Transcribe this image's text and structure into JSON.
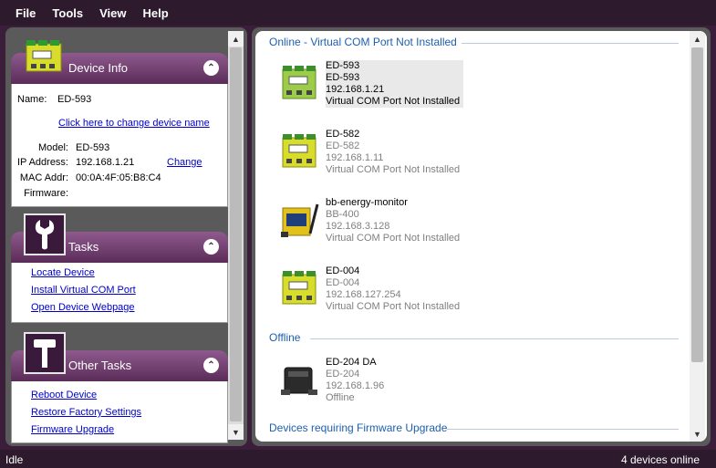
{
  "menu": [
    "File",
    "Tools",
    "View",
    "Help"
  ],
  "device_info": {
    "title": "Device Info",
    "name_label": "Name:",
    "name_value": "ED-593",
    "change_name_link": "Click here to change device name",
    "model_label": "Model:",
    "model_value": "ED-593",
    "ip_label": "IP Address:",
    "ip_value": "192.168.1.21",
    "change_link": "Change",
    "mac_label": "MAC Addr:",
    "mac_value": "00:0A:4F:05:B8:C4",
    "firmware_label": "Firmware:"
  },
  "tasks": {
    "title": "Tasks",
    "items": [
      "Locate Device",
      "Install Virtual COM Port",
      "Open Device Webpage"
    ]
  },
  "other_tasks": {
    "title": "Other Tasks",
    "items": [
      "Reboot Device",
      "Restore Factory Settings",
      "Firmware Upgrade"
    ]
  },
  "groups": {
    "online_title": "Online - Virtual COM Port Not Installed",
    "offline_title": "Offline",
    "firmware_title": "Devices requiring Firmware Upgrade"
  },
  "online_devices": [
    {
      "name": "ED-593",
      "model": "ED-593",
      "ip": "192.168.1.21",
      "status": "Virtual COM Port Not Installed"
    },
    {
      "name": "ED-582",
      "model": "ED-582",
      "ip": "192.168.1.11",
      "status": "Virtual COM Port Not Installed"
    },
    {
      "name": "bb-energy-monitor",
      "model": "BB-400",
      "ip": "192.168.3.128",
      "status": "Virtual COM Port Not Installed"
    },
    {
      "name": "ED-004",
      "model": "ED-004",
      "ip": "192.168.127.254",
      "status": "Virtual COM Port Not Installed"
    }
  ],
  "offline_devices": [
    {
      "name": "ED-204 DA",
      "model": "ED-204",
      "ip": "192.168.1.96",
      "status": "Offline"
    }
  ],
  "status": {
    "left": "Idle",
    "right": "4 devices online"
  }
}
